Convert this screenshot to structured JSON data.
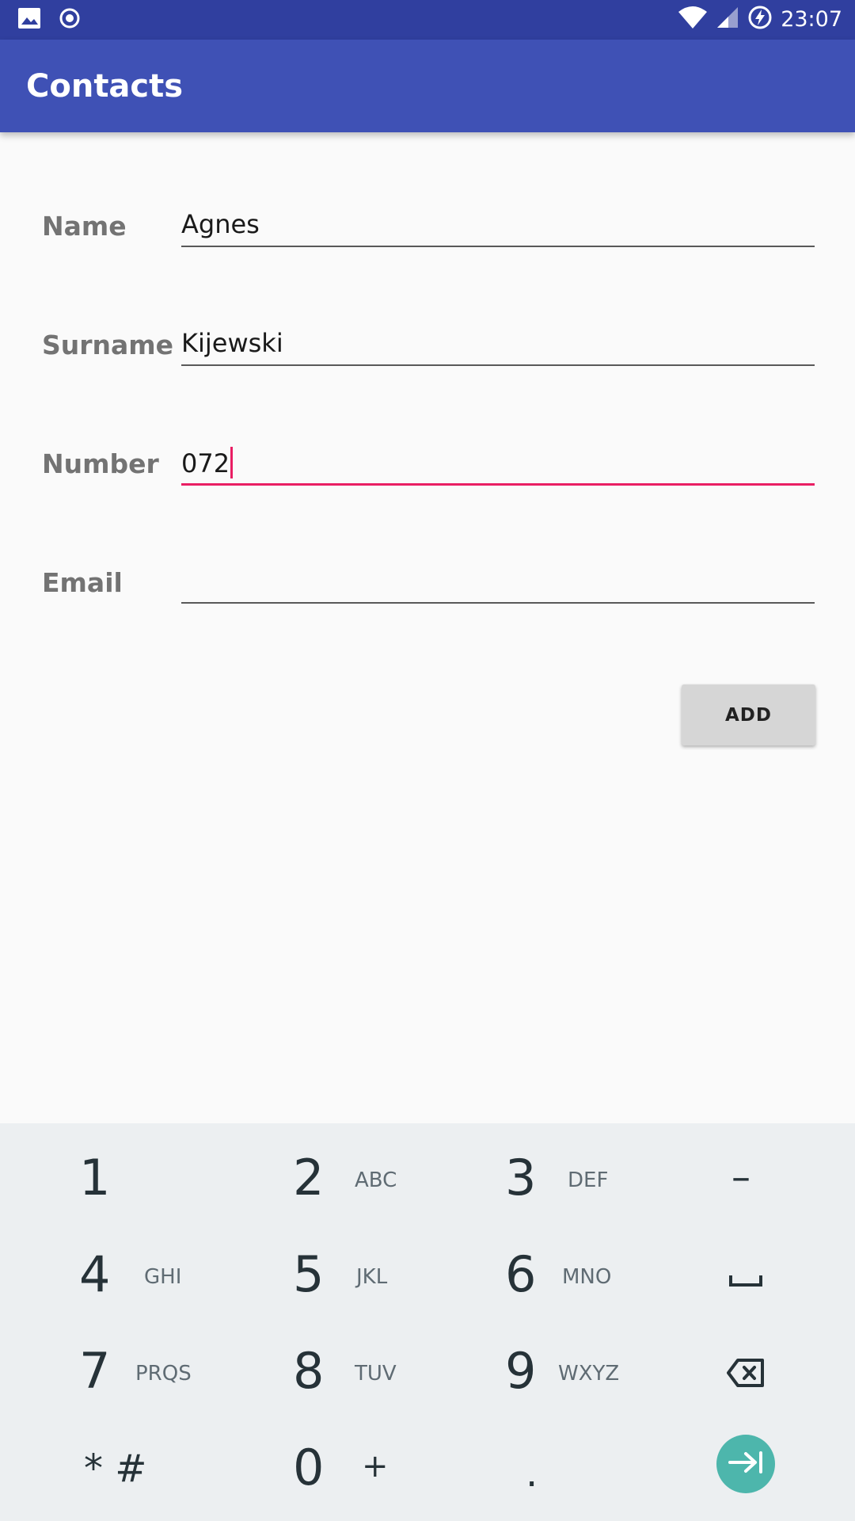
{
  "status_bar": {
    "time": "23:07",
    "icons": [
      "image-icon",
      "record-icon",
      "wifi-icon",
      "cell-signal-icon",
      "battery-charging-icon"
    ]
  },
  "app_bar": {
    "title": "Contacts"
  },
  "form": {
    "name": {
      "label": "Name",
      "value": "Agnes"
    },
    "surname": {
      "label": "Surname",
      "value": "Kijewski"
    },
    "number": {
      "label": "Number",
      "value": "072"
    },
    "email": {
      "label": "Email",
      "value": ""
    },
    "add_label": "ADD"
  },
  "colors": {
    "status_bar": "#303f9f",
    "app_bar": "#3f51b5",
    "accent": "#e91e63",
    "enter_key": "#4db6ac",
    "keyboard_bg": "#eceff1"
  },
  "keypad": {
    "k1": {
      "num": "1",
      "letters": ""
    },
    "k2": {
      "num": "2",
      "letters": "ABC"
    },
    "k3": {
      "num": "3",
      "letters": "DEF"
    },
    "k4": {
      "num": "4",
      "letters": "GHI"
    },
    "k5": {
      "num": "5",
      "letters": "JKL"
    },
    "k6": {
      "num": "6",
      "letters": "MNO"
    },
    "k7": {
      "num": "7",
      "letters": "PRQS"
    },
    "k8": {
      "num": "8",
      "letters": "TUV"
    },
    "k9": {
      "num": "9",
      "letters": "WXYZ"
    },
    "k0": {
      "num": "0",
      "letters": "+"
    },
    "star_hash": "* #",
    "dot": ".",
    "minus": "–"
  }
}
